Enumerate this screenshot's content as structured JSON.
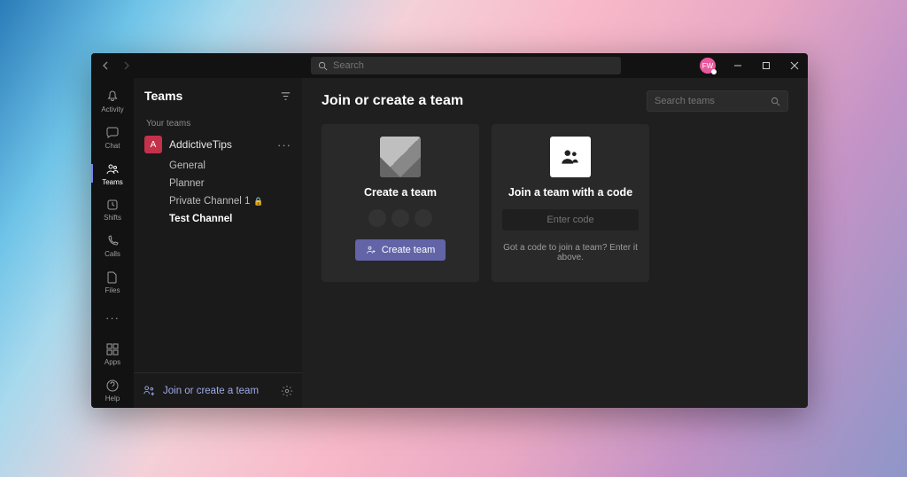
{
  "titlebar": {
    "search_placeholder": "Search",
    "avatar_initials": "FW"
  },
  "rail": {
    "items": [
      {
        "icon": "bell",
        "label": "Activity",
        "active": false
      },
      {
        "icon": "chat",
        "label": "Chat",
        "active": false
      },
      {
        "icon": "teams",
        "label": "Teams",
        "active": true
      },
      {
        "icon": "shifts",
        "label": "Shifts",
        "active": false
      },
      {
        "icon": "calls",
        "label": "Calls",
        "active": false
      },
      {
        "icon": "files",
        "label": "Files",
        "active": false
      }
    ],
    "more": "···",
    "bottom": [
      {
        "icon": "apps",
        "label": "Apps"
      },
      {
        "icon": "help",
        "label": "Help"
      }
    ]
  },
  "sidepanel": {
    "title": "Teams",
    "section_label": "Your teams",
    "team": {
      "name": "AddictiveTips",
      "initial": "A"
    },
    "channels": [
      {
        "label": "General",
        "private": false,
        "bold": false
      },
      {
        "label": "Planner",
        "private": false,
        "bold": false
      },
      {
        "label": "Private Channel 1",
        "private": true,
        "bold": false
      },
      {
        "label": "Test Channel",
        "private": false,
        "bold": true
      }
    ],
    "footer_label": "Join or create a team"
  },
  "main": {
    "title": "Join or create a team",
    "search_placeholder": "Search teams",
    "create_card": {
      "title": "Create a team",
      "button": "Create team"
    },
    "join_card": {
      "title": "Join a team with a code",
      "placeholder": "Enter code",
      "hint": "Got a code to join a team? Enter it above."
    }
  }
}
